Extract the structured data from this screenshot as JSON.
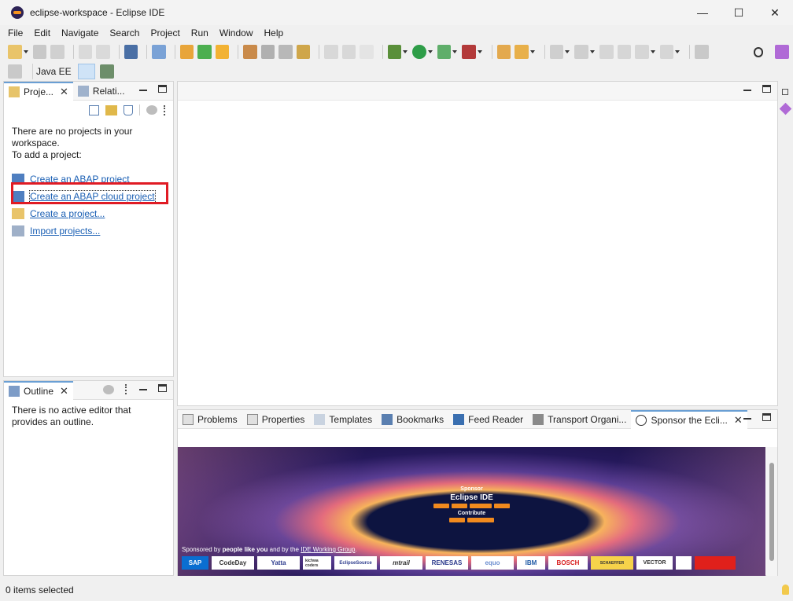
{
  "window": {
    "title": "eclipse-workspace - Eclipse IDE",
    "min": "—",
    "max": "☐",
    "close": "✕"
  },
  "menu": [
    "File",
    "Edit",
    "Navigate",
    "Search",
    "Project",
    "Run",
    "Window",
    "Help"
  ],
  "perspective": {
    "label": "Java EE"
  },
  "project_panel": {
    "tabs": [
      {
        "label": "Proje..."
      },
      {
        "label": "Relati..."
      }
    ],
    "empty_line1": "There are no projects in your workspace.",
    "empty_line2": "To add a project:",
    "links": [
      {
        "label": "Create an ABAP project"
      },
      {
        "label": "Create an ABAP cloud project"
      },
      {
        "label": "Create a project..."
      },
      {
        "label": "Import projects..."
      }
    ]
  },
  "outline": {
    "tab_label": "Outline",
    "message": "There is no active editor that provides an outline."
  },
  "bottom_panel": {
    "tabs": [
      {
        "label": "Problems"
      },
      {
        "label": "Properties"
      },
      {
        "label": "Templates"
      },
      {
        "label": "Bookmarks"
      },
      {
        "label": "Feed Reader"
      },
      {
        "label": "Transport Organi..."
      },
      {
        "label": "Sponsor the Ecli..."
      }
    ]
  },
  "banner": {
    "sponsor": "Sponsor",
    "title": "Eclipse IDE",
    "contribute": "Contribute",
    "sponsored_by_prefix": "Sponsored by ",
    "sponsored_by_people": "people like you",
    "sponsored_by_mid": " and by the ",
    "sponsored_by_group": "IDE Working Group",
    "sponsored_by_suffix": ".",
    "logos": [
      "SAP",
      "CodeDay",
      "Yatta",
      "kichwa coders",
      "EclipseSource",
      "mtrail",
      "RENESAS",
      "equo",
      "IBM",
      "BOSCH",
      "SCHAEFFER",
      "VECTOR",
      "",
      ""
    ]
  },
  "status": {
    "text": "0 items selected"
  }
}
